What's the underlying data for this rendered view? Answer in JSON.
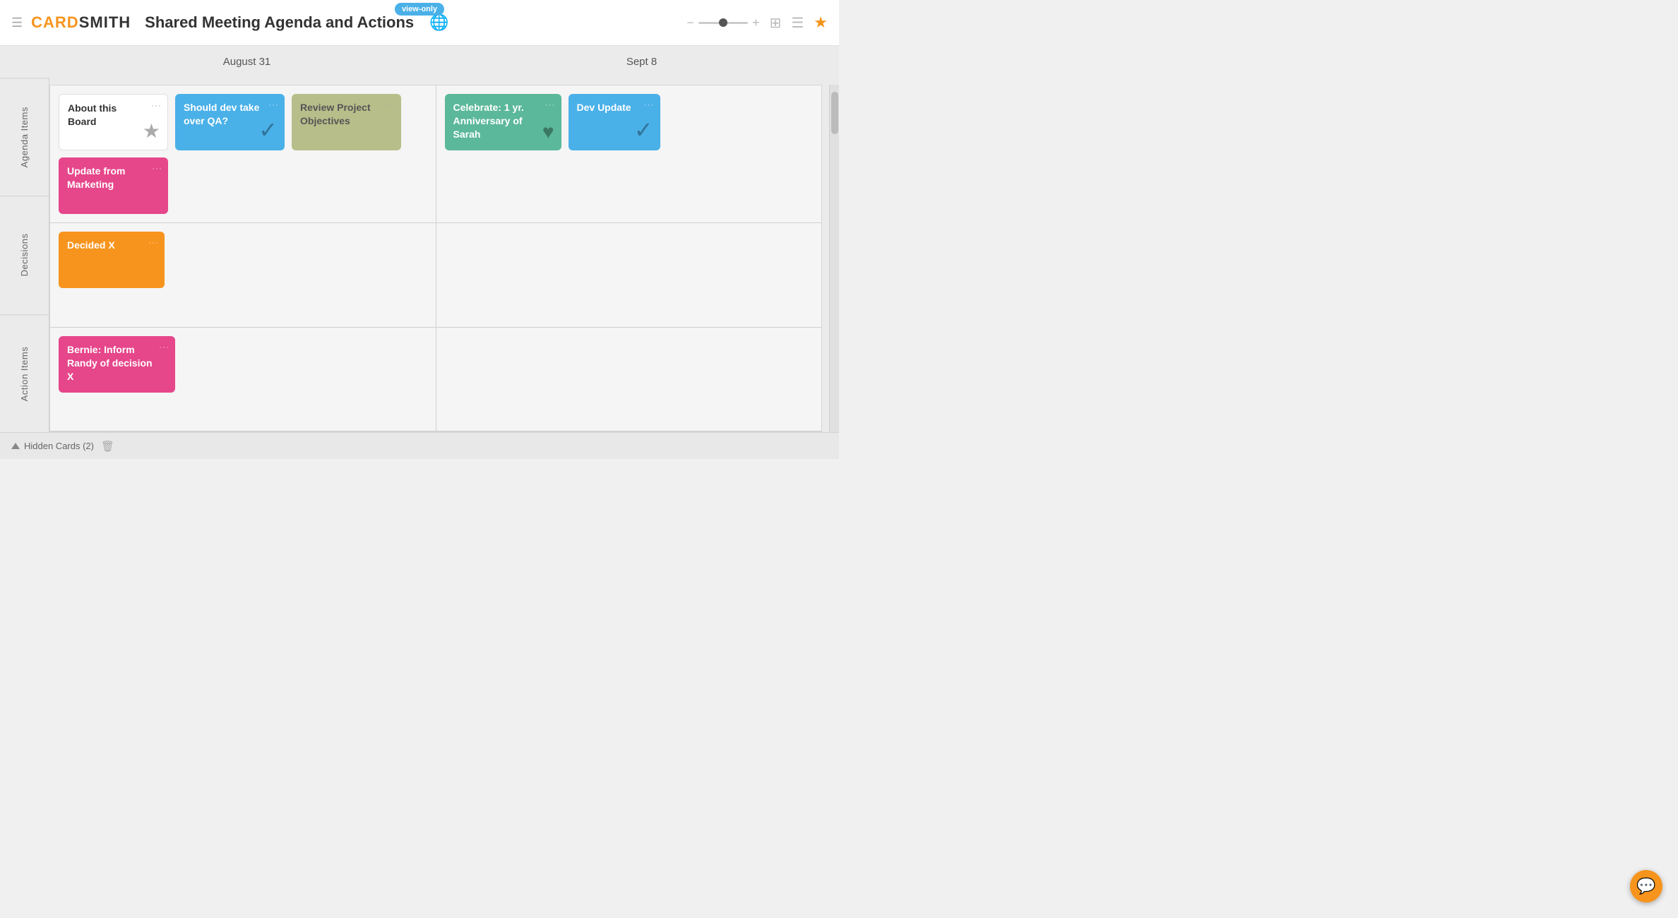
{
  "header": {
    "menu_icon": "☰",
    "logo_card": "card",
    "logo_smith": "smith",
    "board_title": "Shared Meeting Agenda and Actions",
    "view_only_label": "view-only",
    "globe_icon": "🌐",
    "zoom_minus": "−",
    "zoom_plus": "+",
    "grid_icon": "⊞",
    "minus_icon": "−",
    "star_icon": "★"
  },
  "columns": [
    {
      "label": "August 31"
    },
    {
      "label": "Sept 8"
    }
  ],
  "rows": [
    {
      "label": "Agenda Items",
      "cells": [
        {
          "cards": [
            {
              "id": "about-board",
              "title": "About this Board",
              "color": "white",
              "icon": "star",
              "icon_char": "☆"
            },
            {
              "id": "should-dev",
              "title": "Should dev take over QA?",
              "color": "blue",
              "icon": "checkmark",
              "icon_char": "✓"
            },
            {
              "id": "review-project",
              "title": "Review Project Objectives",
              "color": "olive",
              "icon": "none",
              "icon_char": ""
            },
            {
              "id": "update-marketing",
              "title": "Update from Marketing",
              "color": "pink",
              "icon": "none",
              "icon_char": ""
            }
          ]
        },
        {
          "cards": [
            {
              "id": "celebrate-sarah",
              "title": "Celebrate: 1 yr. Anniversary of Sarah",
              "color": "teal",
              "icon": "heart",
              "icon_char": "♥"
            },
            {
              "id": "dev-update",
              "title": "Dev Update",
              "color": "blue",
              "icon": "checkmark",
              "icon_char": "✓"
            }
          ]
        }
      ]
    },
    {
      "label": "Decisions",
      "cells": [
        {
          "cards": [
            {
              "id": "decided-x",
              "title": "Decided X",
              "color": "orange",
              "icon": "none",
              "icon_char": ""
            }
          ]
        },
        {
          "cards": []
        }
      ]
    },
    {
      "label": "Action Items",
      "cells": [
        {
          "cards": [
            {
              "id": "bernie-inform",
              "title": "Bernie: Inform Randy of decision X",
              "color": "pink",
              "icon": "none",
              "icon_char": ""
            }
          ]
        },
        {
          "cards": []
        }
      ]
    }
  ],
  "bottom_bar": {
    "hidden_cards_label": "Hidden Cards (2)",
    "trash_icon": "🗑"
  },
  "chat_button": {
    "icon": "💬"
  }
}
